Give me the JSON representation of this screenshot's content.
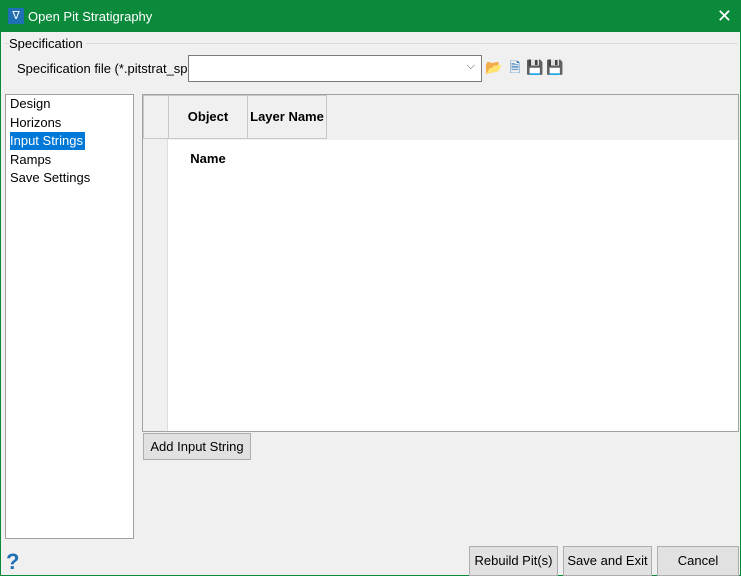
{
  "window": {
    "title": "Open Pit Stratigraphy"
  },
  "specification": {
    "group_label": "Specification",
    "file_label": "Specification file (*.pitstrat_spec)",
    "file_value": ""
  },
  "nav": {
    "items": [
      {
        "label": "Design"
      },
      {
        "label": "Horizons"
      },
      {
        "label": "Input Strings"
      },
      {
        "label": "Ramps"
      },
      {
        "label": "Save Settings"
      }
    ],
    "selected": "Input Strings"
  },
  "table": {
    "columns": [
      "Object Name",
      "Layer Name"
    ],
    "rows": []
  },
  "buttons": {
    "add_input_string": "Add Input String",
    "rebuild": "Rebuild Pit(s)",
    "save_exit": "Save and Exit",
    "cancel": "Cancel"
  },
  "colors": {
    "titlebar": "#0c8a3c",
    "selection": "#0078d7"
  }
}
